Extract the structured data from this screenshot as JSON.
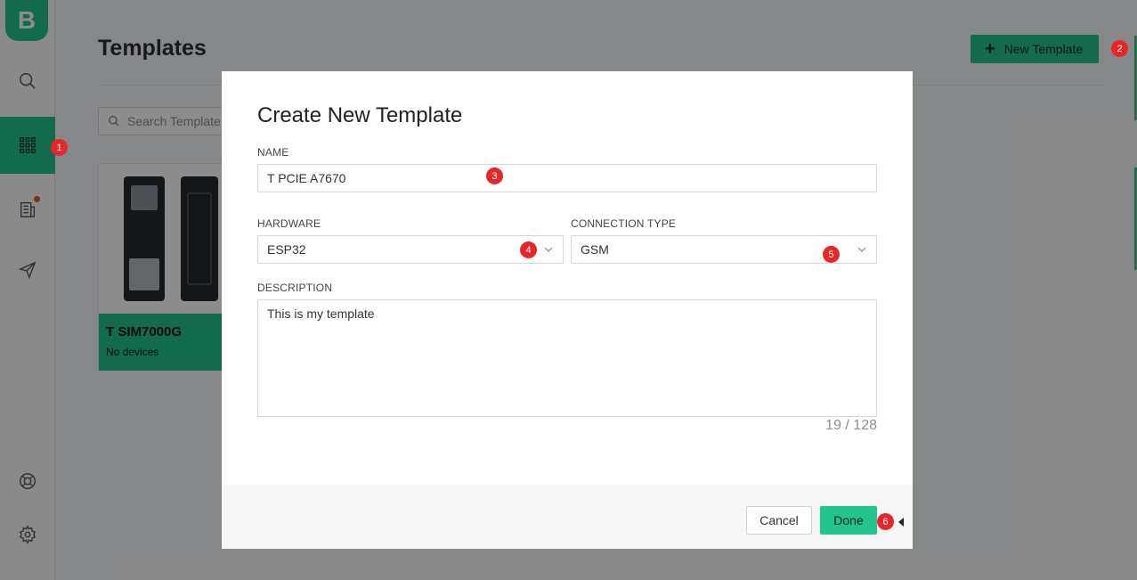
{
  "app": {
    "logo_letter": "B",
    "accent_color": "#23c48e"
  },
  "sidebar": {
    "items": [
      {
        "name": "search",
        "icon": "search-icon"
      },
      {
        "name": "templates",
        "icon": "grid-icon",
        "active": true
      },
      {
        "name": "organizations",
        "icon": "building-icon",
        "has_notification": true
      },
      {
        "name": "messages",
        "icon": "paper-plane-icon"
      },
      {
        "name": "help",
        "icon": "lifebuoy-icon"
      },
      {
        "name": "settings",
        "icon": "gear-icon"
      }
    ]
  },
  "page": {
    "title": "Templates",
    "new_button_label": "New Template",
    "search_placeholder": "Search Template"
  },
  "template_card": {
    "title": "T SIM7000G",
    "subtitle": "No devices"
  },
  "modal": {
    "title": "Create New Template",
    "name_label": "NAME",
    "name_value": "T PCIE A7670",
    "hardware_label": "HARDWARE",
    "hardware_value": "ESP32",
    "connection_label": "CONNECTION TYPE",
    "connection_value": "GSM",
    "description_label": "DESCRIPTION",
    "description_value": "This is my template",
    "char_counter": "19 / 128",
    "cancel_label": "Cancel",
    "done_label": "Done"
  },
  "markers": [
    "1",
    "2",
    "3",
    "4",
    "5",
    "6"
  ]
}
